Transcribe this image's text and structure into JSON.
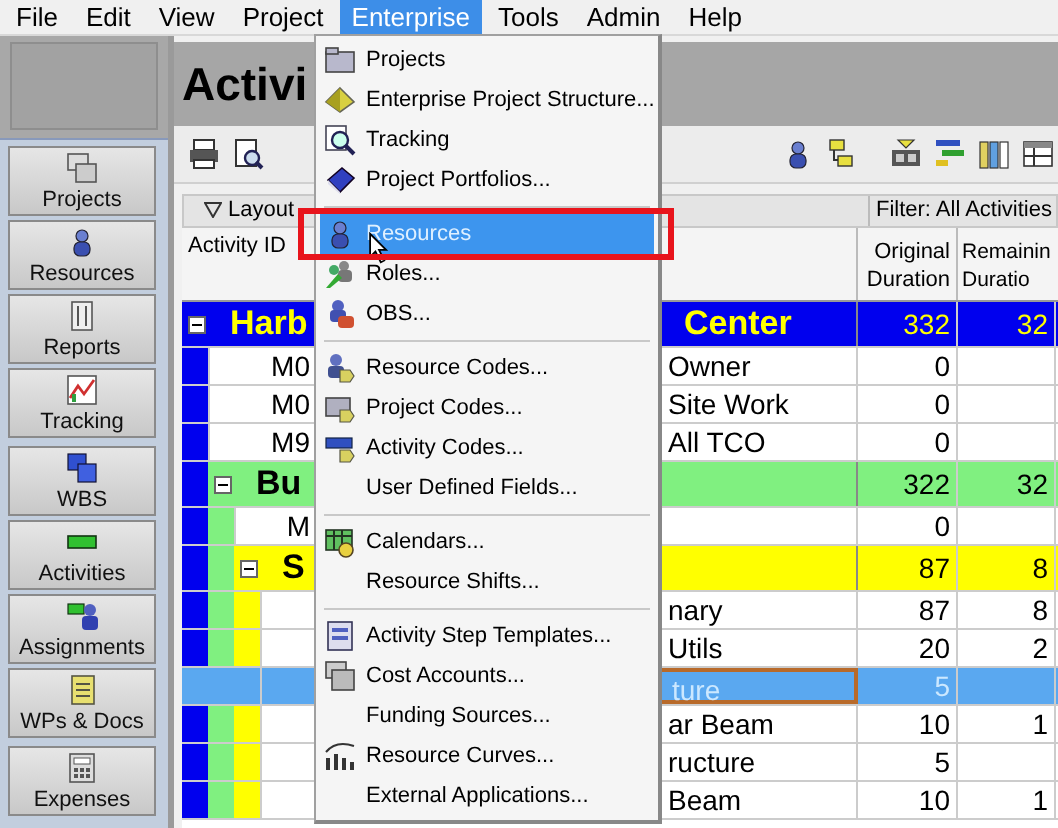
{
  "menubar": [
    {
      "label": "File",
      "selected": false
    },
    {
      "label": "Edit",
      "selected": false
    },
    {
      "label": "View",
      "selected": false
    },
    {
      "label": "Project",
      "selected": false
    },
    {
      "label": "Enterprise",
      "selected": true
    },
    {
      "label": "Tools",
      "selected": false
    },
    {
      "label": "Admin",
      "selected": false
    },
    {
      "label": "Help",
      "selected": false
    }
  ],
  "sidebar": {
    "groups": [
      [
        {
          "label": "Projects"
        },
        {
          "label": "Resources"
        },
        {
          "label": "Reports"
        },
        {
          "label": "Tracking"
        }
      ],
      [
        {
          "label": "WBS"
        },
        {
          "label": "Activities"
        },
        {
          "label": "Assignments"
        },
        {
          "label": "WPs & Docs"
        }
      ],
      [
        {
          "label": "Expenses"
        }
      ]
    ]
  },
  "view": {
    "title": "Activi"
  },
  "layout_bar": {
    "layout": "Layout",
    "filter": "Filter: All Activities"
  },
  "table": {
    "columns": [
      "Activity ID",
      "Original Duration",
      "Remainin Duratio"
    ],
    "rows": [
      {
        "kind": "wbs",
        "id": "Harb",
        "name": "Center",
        "original": "332",
        "remaining": "32",
        "color": "#0000ee",
        "expanded": true,
        "children": [
          {
            "kind": "activity",
            "id": "M0",
            "name": "Owner",
            "original": "0",
            "selected": false
          },
          {
            "kind": "activity",
            "id": "M0",
            "name": "Site Work",
            "original": "0",
            "selected": false
          },
          {
            "kind": "activity",
            "id": "M9",
            "name": "All TCO",
            "original": "0",
            "selected": false
          },
          {
            "kind": "wbs",
            "id": "Bu",
            "original": "322",
            "remaining": "32",
            "color": "#80f080",
            "expanded": true,
            "children": [
              {
                "kind": "activity",
                "id": "M",
                "original": "0",
                "selected": false
              },
              {
                "kind": "wbs",
                "id": "S",
                "original": "87",
                "remaining": "8",
                "color": "#ffff00",
                "expanded": true,
                "children": [
                  {
                    "kind": "activity",
                    "name": "nary",
                    "original": "87",
                    "remaining": "8",
                    "selected": false
                  },
                  {
                    "kind": "activity",
                    "name": "Utils",
                    "original": "20",
                    "remaining": "2",
                    "selected": false
                  },
                  {
                    "kind": "activity",
                    "name": "ture",
                    "original": "5",
                    "selected": true
                  },
                  {
                    "kind": "activity",
                    "name": "ar Beam",
                    "original": "10",
                    "remaining": "1",
                    "selected": false
                  },
                  {
                    "kind": "activity",
                    "name": "ructure",
                    "original": "5",
                    "selected": false
                  },
                  {
                    "kind": "activity",
                    "name": "Beam",
                    "original": "10",
                    "remaining": "1",
                    "selected": false
                  }
                ]
              }
            ]
          }
        ]
      }
    ]
  },
  "menu": {
    "items": [
      {
        "kind": "item",
        "label": "Projects",
        "selected": false,
        "annotated": false
      },
      {
        "kind": "item",
        "label": "Enterprise Project Structure...",
        "selected": false,
        "annotated": false
      },
      {
        "kind": "item",
        "label": "Tracking",
        "selected": false,
        "annotated": false
      },
      {
        "kind": "item",
        "label": "Project Portfolios...",
        "selected": false,
        "annotated": false
      },
      {
        "kind": "separator"
      },
      {
        "kind": "item",
        "label": "Resources",
        "selected": true,
        "annotated": true
      },
      {
        "kind": "item",
        "label": "Roles...",
        "selected": false,
        "annotated": false
      },
      {
        "kind": "item",
        "label": "OBS...",
        "selected": false,
        "annotated": false
      },
      {
        "kind": "separator"
      },
      {
        "kind": "item",
        "label": "Resource Codes...",
        "selected": false,
        "annotated": false
      },
      {
        "kind": "item",
        "label": "Project Codes...",
        "selected": false,
        "annotated": false
      },
      {
        "kind": "item",
        "label": "Activity Codes...",
        "selected": false,
        "annotated": false
      },
      {
        "kind": "item",
        "label": "User Defined Fields...",
        "selected": false,
        "annotated": false
      },
      {
        "kind": "separator"
      },
      {
        "kind": "item",
        "label": "Calendars...",
        "selected": false,
        "annotated": false
      },
      {
        "kind": "item",
        "label": "Resource Shifts...",
        "selected": false,
        "annotated": false
      },
      {
        "kind": "separator"
      },
      {
        "kind": "item",
        "label": "Activity Step Templates...",
        "selected": false,
        "annotated": false
      },
      {
        "kind": "item",
        "label": "Cost Accounts...",
        "selected": false,
        "annotated": false
      },
      {
        "kind": "item",
        "label": "Funding Sources...",
        "selected": false,
        "annotated": false
      },
      {
        "kind": "item",
        "label": "Resource Curves...",
        "selected": false,
        "annotated": false
      },
      {
        "kind": "item",
        "label": "External Applications...",
        "selected": false,
        "annotated": false
      }
    ]
  }
}
